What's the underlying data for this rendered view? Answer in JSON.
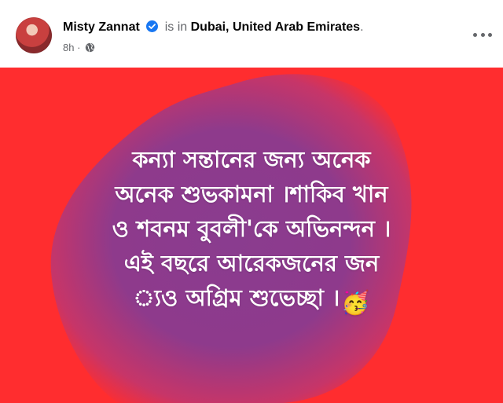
{
  "post": {
    "author": "Misty Zannat",
    "status_prefix": "is in",
    "location": "Dubai, United Arab Emirates",
    "location_suffix": ".",
    "time": "8h",
    "separator": "·",
    "audience_icon": "globe-icon",
    "more_icon": "more-options-icon",
    "verified_icon": "verified-badge-icon",
    "message_lines": [
      "কন্যা সন্তানের জন্য অনেক",
      "অনেক শুভকামনা ।শাকিব খান",
      "ও শবনম বুবলী'কে অভিনন্দন ।",
      "এই বছরে আরেকজনের জন",
      "্যও অগ্রিম শুভেচ্ছা ।"
    ],
    "emoji": "🥳",
    "emoji_icon": "partying-face-emoji",
    "colors": {
      "background": "#ff2d2f",
      "blob": "#8a3c8f",
      "text": "#ffffff",
      "verified": "#1877f2"
    }
  }
}
